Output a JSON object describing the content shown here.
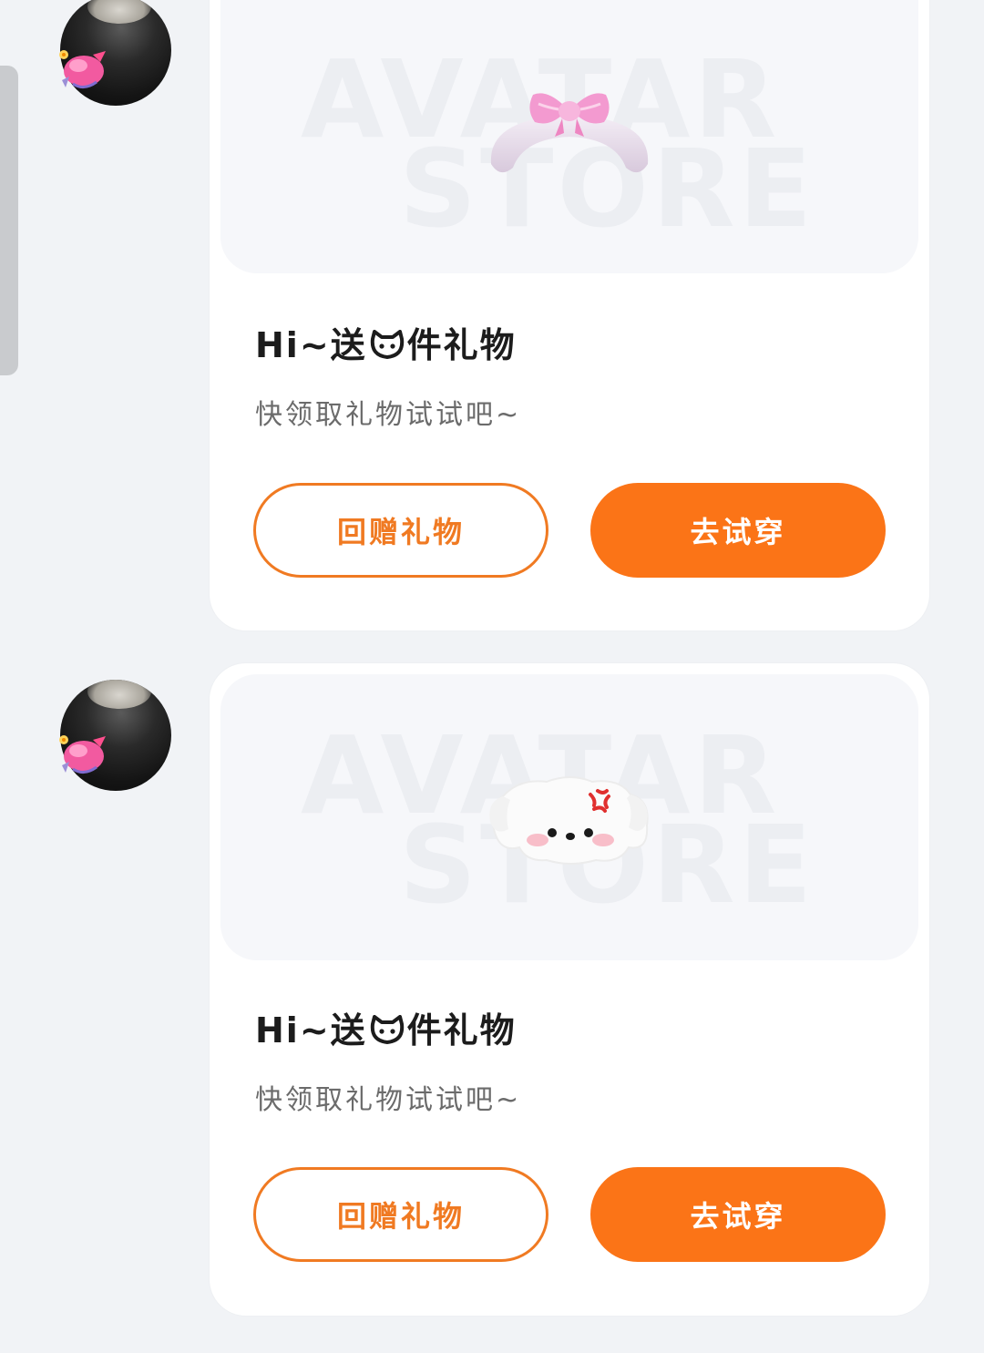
{
  "messages": [
    {
      "avatar_alt": "user-avatar",
      "gift_icon": "bow-headband",
      "title_prefix": "Hi~送",
      "title_suffix": "件礼物",
      "subtitle": "快领取礼物试试吧~",
      "watermark_line1": "AVATAR",
      "watermark_line2": "STORE",
      "return_gift_label": "回赠礼物",
      "try_on_label": "去试穿"
    },
    {
      "avatar_alt": "user-avatar",
      "gift_icon": "angry-puppy-head",
      "title_prefix": "Hi~送",
      "title_suffix": "件礼物",
      "subtitle": "快领取礼物试试吧~",
      "watermark_line1": "AVATAR",
      "watermark_line2": "STORE",
      "return_gift_label": "回赠礼物",
      "try_on_label": "去试穿"
    }
  ],
  "colors": {
    "accent": "#fb7417",
    "accent_outline": "#f07a22",
    "background": "#f1f3f6",
    "card": "#ffffff"
  }
}
